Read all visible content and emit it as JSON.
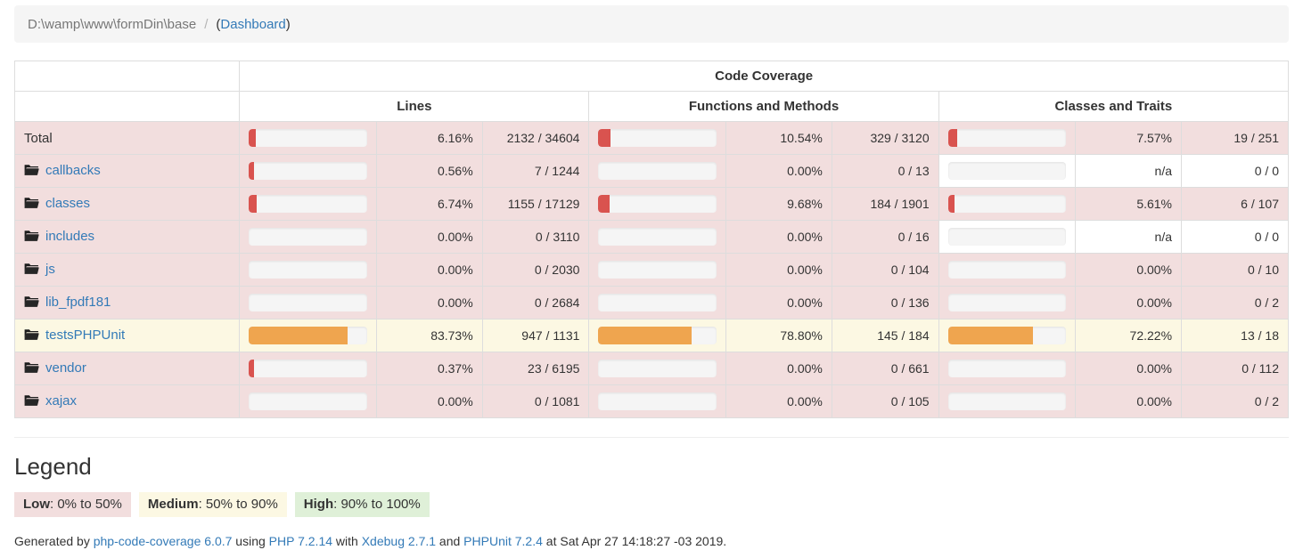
{
  "breadcrumb": {
    "path": "D:\\wamp\\www\\formDin\\base",
    "separator": "/",
    "open_paren": "(",
    "dashboard_link": "Dashboard",
    "close_paren": ")"
  },
  "table": {
    "group_header": "Code Coverage",
    "column_groups": [
      "Lines",
      "Functions and Methods",
      "Classes and Traits"
    ],
    "rows": [
      {
        "name": "Total",
        "is_total": true,
        "level": "low",
        "lines": {
          "bar_pct": 6.16,
          "percent": "6.16%",
          "absolute": "2132 / 34604",
          "bar_level": "danger"
        },
        "functions": {
          "bar_pct": 10.54,
          "percent": "10.54%",
          "absolute": "329 / 3120",
          "bar_level": "danger"
        },
        "classes": {
          "bar_pct": 7.57,
          "percent": "7.57%",
          "absolute": "19 / 251",
          "bar_level": "danger"
        }
      },
      {
        "name": "callbacks",
        "is_total": false,
        "level": "low",
        "lines": {
          "bar_pct": 0.56,
          "percent": "0.56%",
          "absolute": "7 / 1244",
          "bar_level": "danger"
        },
        "functions": {
          "bar_pct": 0.0,
          "percent": "0.00%",
          "absolute": "0 / 13",
          "bar_level": "empty"
        },
        "classes": {
          "bar_pct": 0.0,
          "percent": "n/a",
          "absolute": "0 / 0",
          "bar_level": "empty",
          "na": true
        }
      },
      {
        "name": "classes",
        "is_total": false,
        "level": "low",
        "lines": {
          "bar_pct": 6.74,
          "percent": "6.74%",
          "absolute": "1155 / 17129",
          "bar_level": "danger"
        },
        "functions": {
          "bar_pct": 9.68,
          "percent": "9.68%",
          "absolute": "184 / 1901",
          "bar_level": "danger"
        },
        "classes": {
          "bar_pct": 5.61,
          "percent": "5.61%",
          "absolute": "6 / 107",
          "bar_level": "danger"
        }
      },
      {
        "name": "includes",
        "is_total": false,
        "level": "low",
        "lines": {
          "bar_pct": 0.0,
          "percent": "0.00%",
          "absolute": "0 / 3110",
          "bar_level": "empty"
        },
        "functions": {
          "bar_pct": 0.0,
          "percent": "0.00%",
          "absolute": "0 / 16",
          "bar_level": "empty"
        },
        "classes": {
          "bar_pct": 0.0,
          "percent": "n/a",
          "absolute": "0 / 0",
          "bar_level": "empty",
          "na": true
        }
      },
      {
        "name": "js",
        "is_total": false,
        "level": "low",
        "lines": {
          "bar_pct": 0.0,
          "percent": "0.00%",
          "absolute": "0 / 2030",
          "bar_level": "empty"
        },
        "functions": {
          "bar_pct": 0.0,
          "percent": "0.00%",
          "absolute": "0 / 104",
          "bar_level": "empty"
        },
        "classes": {
          "bar_pct": 0.0,
          "percent": "0.00%",
          "absolute": "0 / 10",
          "bar_level": "empty"
        }
      },
      {
        "name": "lib_fpdf181",
        "is_total": false,
        "level": "low",
        "lines": {
          "bar_pct": 0.0,
          "percent": "0.00%",
          "absolute": "0 / 2684",
          "bar_level": "empty"
        },
        "functions": {
          "bar_pct": 0.0,
          "percent": "0.00%",
          "absolute": "0 / 136",
          "bar_level": "empty"
        },
        "classes": {
          "bar_pct": 0.0,
          "percent": "0.00%",
          "absolute": "0 / 2",
          "bar_level": "empty"
        }
      },
      {
        "name": "testsPHPUnit",
        "is_total": false,
        "level": "medium",
        "lines": {
          "bar_pct": 83.73,
          "percent": "83.73%",
          "absolute": "947 / 1131",
          "bar_level": "warning"
        },
        "functions": {
          "bar_pct": 78.8,
          "percent": "78.80%",
          "absolute": "145 / 184",
          "bar_level": "warning"
        },
        "classes": {
          "bar_pct": 72.22,
          "percent": "72.22%",
          "absolute": "13 / 18",
          "bar_level": "warning"
        }
      },
      {
        "name": "vendor",
        "is_total": false,
        "level": "low",
        "lines": {
          "bar_pct": 0.37,
          "percent": "0.37%",
          "absolute": "23 / 6195",
          "bar_level": "danger"
        },
        "functions": {
          "bar_pct": 0.0,
          "percent": "0.00%",
          "absolute": "0 / 661",
          "bar_level": "empty"
        },
        "classes": {
          "bar_pct": 0.0,
          "percent": "0.00%",
          "absolute": "0 / 112",
          "bar_level": "empty"
        }
      },
      {
        "name": "xajax",
        "is_total": false,
        "level": "low",
        "lines": {
          "bar_pct": 0.0,
          "percent": "0.00%",
          "absolute": "0 / 1081",
          "bar_level": "empty"
        },
        "functions": {
          "bar_pct": 0.0,
          "percent": "0.00%",
          "absolute": "0 / 105",
          "bar_level": "empty"
        },
        "classes": {
          "bar_pct": 0.0,
          "percent": "0.00%",
          "absolute": "0 / 2",
          "bar_level": "empty"
        }
      }
    ]
  },
  "legend": {
    "title": "Legend",
    "items": [
      {
        "label": "Low",
        "range": ": 0% to 50%",
        "class": "lg-low",
        "color": "#f2dede"
      },
      {
        "label": "Medium",
        "range": ": 50% to 90%",
        "class": "lg-medium",
        "color": "#fcf8e3"
      },
      {
        "label": "High",
        "range": ": 90% to 100%",
        "class": "lg-high",
        "color": "#dff0d8"
      }
    ]
  },
  "footer": {
    "generated_by": "Generated by",
    "tool_name": "php-code-coverage",
    "tool_version": "6.0.7",
    "using": "using",
    "php_name": "PHP",
    "php_version": "7.2.14",
    "with": "with",
    "xdebug_name": "Xdebug",
    "xdebug_version": "2.7.1",
    "and": "and",
    "phpunit_name": "PHPUnit",
    "phpunit_version": "7.2.4",
    "at": "at",
    "timestamp": "Sat Apr 27 14:18:27 -03 2019."
  },
  "colors": {
    "danger": "#d9534f",
    "warning": "#efa54f",
    "success": "#5cb85c",
    "link": "#337ab7",
    "row_low": "#f2dede",
    "row_medium": "#fcf8e3",
    "row_high": "#dff0d8",
    "bar_track": "#f5f5f5"
  },
  "icons": {
    "folder": "folder-icon"
  }
}
